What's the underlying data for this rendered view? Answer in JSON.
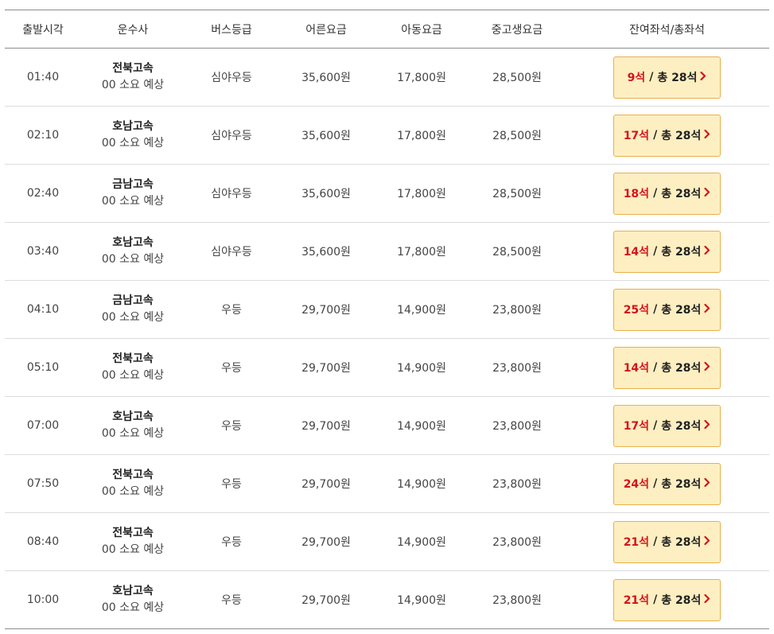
{
  "headers": {
    "departure": "출발시각",
    "company": "운수사",
    "grade": "버스등급",
    "adult": "어른요금",
    "child": "아동요금",
    "student": "중고생요금",
    "seats": "잔여좌석/총좌석"
  },
  "rows": [
    {
      "time": "01:40",
      "company": "전북고속",
      "duration": "00 소요 예상",
      "grade": "심야우등",
      "adult": "35,600원",
      "child": "17,800원",
      "student": "28,500원",
      "remain": "9석",
      "total": "총 28석"
    },
    {
      "time": "02:10",
      "company": "호남고속",
      "duration": "00 소요 예상",
      "grade": "심야우등",
      "adult": "35,600원",
      "child": "17,800원",
      "student": "28,500원",
      "remain": "17석",
      "total": "총 28석"
    },
    {
      "time": "02:40",
      "company": "금남고속",
      "duration": "00 소요 예상",
      "grade": "심야우등",
      "adult": "35,600원",
      "child": "17,800원",
      "student": "28,500원",
      "remain": "18석",
      "total": "총 28석"
    },
    {
      "time": "03:40",
      "company": "호남고속",
      "duration": "00 소요 예상",
      "grade": "심야우등",
      "adult": "35,600원",
      "child": "17,800원",
      "student": "28,500원",
      "remain": "14석",
      "total": "총 28석"
    },
    {
      "time": "04:10",
      "company": "금남고속",
      "duration": "00 소요 예상",
      "grade": "우등",
      "adult": "29,700원",
      "child": "14,900원",
      "student": "23,800원",
      "remain": "25석",
      "total": "총 28석"
    },
    {
      "time": "05:10",
      "company": "전북고속",
      "duration": "00 소요 예상",
      "grade": "우등",
      "adult": "29,700원",
      "child": "14,900원",
      "student": "23,800원",
      "remain": "14석",
      "total": "총 28석"
    },
    {
      "time": "07:00",
      "company": "호남고속",
      "duration": "00 소요 예상",
      "grade": "우등",
      "adult": "29,700원",
      "child": "14,900원",
      "student": "23,800원",
      "remain": "17석",
      "total": "총 28석"
    },
    {
      "time": "07:50",
      "company": "전북고속",
      "duration": "00 소요 예상",
      "grade": "우등",
      "adult": "29,700원",
      "child": "14,900원",
      "student": "23,800원",
      "remain": "24석",
      "total": "총 28석"
    },
    {
      "time": "08:40",
      "company": "전북고속",
      "duration": "00 소요 예상",
      "grade": "우등",
      "adult": "29,700원",
      "child": "14,900원",
      "student": "23,800원",
      "remain": "21석",
      "total": "총 28석"
    },
    {
      "time": "10:00",
      "company": "호남고속",
      "duration": "00 소요 예상",
      "grade": "우등",
      "adult": "29,700원",
      "child": "14,900원",
      "student": "23,800원",
      "remain": "21석",
      "total": "총 28석"
    }
  ],
  "seat_separator": "/",
  "colors": {
    "remain_text": "#d6111e",
    "button_bg": "#fdefc1",
    "button_border": "#e8b04c"
  },
  "icons": {
    "seat_button_arrow": "chevron-right-icon"
  }
}
